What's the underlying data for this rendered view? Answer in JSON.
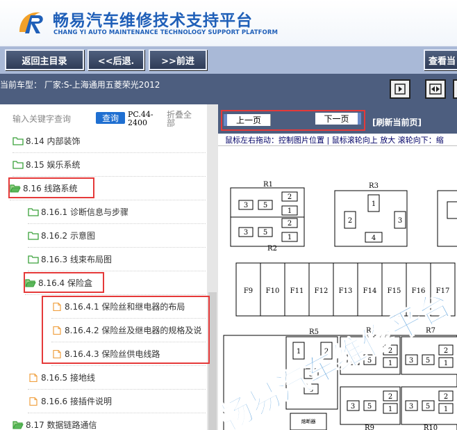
{
  "header": {
    "title": "畅易汽车维修技术支持平台",
    "subtitle": "CHANG YI AUTO MAINTENANCE TECHNOLOGY SUPPORT PLATFORM"
  },
  "toolbar": {
    "home_label": "返回主目录",
    "back_label": "<<后退.",
    "forward_label": ">>前进",
    "view_label": "查看当"
  },
  "infobar": {
    "car_type": "当前车型：  厂家:S-上海通用五菱荣光2012"
  },
  "search": {
    "placeholder": "输入关键字查询",
    "button": "查询",
    "pc_label": "PC.44-2400",
    "collapse_all": "折叠全部"
  },
  "tree": {
    "items": [
      {
        "label": "8.14 内部装饰",
        "type": "folder"
      },
      {
        "label": "8.15 娱乐系统",
        "type": "folder"
      },
      {
        "label": "8.16 线路系统",
        "type": "folder-open"
      },
      {
        "label": "8.16.1 诊断信息与步骤",
        "type": "folder"
      },
      {
        "label": "8.16.2 示意图",
        "type": "folder"
      },
      {
        "label": "8.16.3 线束布局图",
        "type": "folder"
      },
      {
        "label": "8.16.4 保险盒",
        "type": "folder-open"
      },
      {
        "label": "8.16.4.1 保险丝和继电器的布局",
        "type": "doc"
      },
      {
        "label": "8.16.4.2 保险丝及继电器的规格及说",
        "type": "doc"
      },
      {
        "label": "8.16.4.3 保险丝供电线路",
        "type": "doc"
      },
      {
        "label": "8.16.5 接地线",
        "type": "doc"
      },
      {
        "label": "8.16.6 接插件说明",
        "type": "doc"
      },
      {
        "label": "8.17 数据链路通信",
        "type": "folder-open"
      }
    ]
  },
  "viewer": {
    "prev_label": "上一页",
    "next_label": "下一页",
    "refresh_label": "[刷新当前页]",
    "hint": "鼠标左右拖动：控制图片位置 | 鼠标滚轮向上 放大  滚轮向下：缩",
    "watermark": "畅易汽车维修平台",
    "diagram": {
      "relays": [
        "R1",
        "R2",
        "R3",
        "R5",
        "R6",
        "R7",
        "R9",
        "R10"
      ],
      "fuses": [
        "F9",
        "F10",
        "F11",
        "F12",
        "F13",
        "F14",
        "F15",
        "F16",
        "F17"
      ],
      "pins": [
        "1",
        "2",
        "3",
        "4",
        "5"
      ],
      "small_label": "熔断器"
    }
  },
  "colors": {
    "brand": "#1f5fb8",
    "toolbar_bg": "#a9b9d7",
    "bar_dark": "#4d5e7f",
    "highlight": "#e53939",
    "folder_green": "#3aa13a",
    "doc_orange": "#f0a040"
  }
}
